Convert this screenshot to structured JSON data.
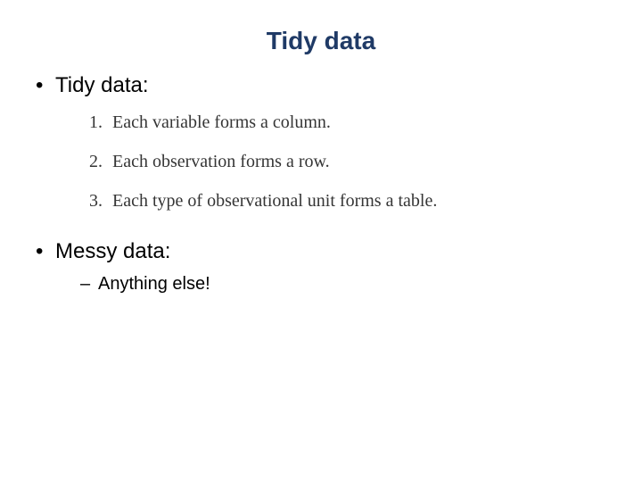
{
  "title": "Tidy data",
  "bullets": {
    "tidy_label": "Tidy data:",
    "messy_label": "Messy data:"
  },
  "principles": [
    "Each variable forms a column.",
    "Each observation forms a row.",
    "Each type of observational unit forms a table."
  ],
  "messy_sub": "Anything else!"
}
